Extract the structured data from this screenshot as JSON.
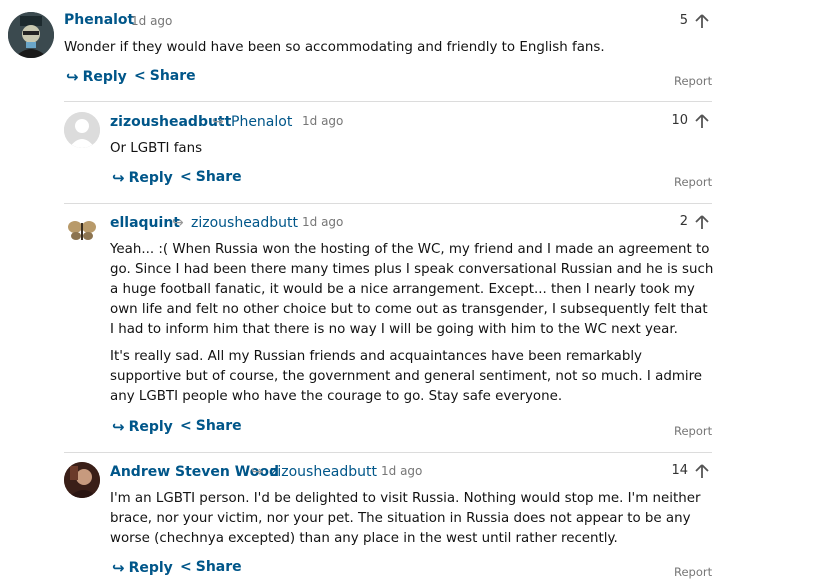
{
  "comments": [
    {
      "username": "Phenalot",
      "time": "1d ago",
      "votes": "5",
      "paragraphs": [
        "Wonder if they would have been so accommodating and friendly to English fans."
      ],
      "reply": "Reply",
      "share": "Share",
      "report": "Report"
    },
    {
      "username": "zizousheadbutt",
      "reply_to": "Phenalot",
      "time": "1d ago",
      "votes": "10",
      "paragraphs": [
        "Or LGBTI fans"
      ],
      "reply": "Reply",
      "share": "Share",
      "report": "Report"
    },
    {
      "username": "ellaquint",
      "reply_to": "zizousheadbutt",
      "time": "1d ago",
      "votes": "2",
      "paragraphs": [
        "Yeah... :( When Russia won the hosting of the WC, my friend and I made an agreement to go. Since I had been there many times plus I speak conversational Russian and he is such a huge football fanatic, it would be a nice arrangement. Except... then I nearly took my own life and felt no other choice but to come out as transgender, I subsequently felt that I had to inform him that there is no way I will be going with him to the WC next year.",
        "It's really sad. All my Russian friends and acquaintances have been remarkably supportive but of course, the government and general sentiment, not so much. I admire any LGBTI people who have the courage to go. Stay safe everyone."
      ],
      "reply": "Reply",
      "share": "Share",
      "report": "Report"
    },
    {
      "username": "Andrew Steven Wood",
      "reply_to": "zizousheadbutt",
      "time": "1d ago",
      "votes": "14",
      "paragraphs": [
        "I'm an LGBTI person. I'd be delighted to visit Russia. Nothing would stop me. I'm neither brace, nor your victim, nor your pet. The situation in Russia does not appear to be any worse (chechnya excepted) than any place in the west until rather recently."
      ],
      "reply": "Reply",
      "share": "Share",
      "report": "Report"
    }
  ],
  "colors": {
    "link": "#005689",
    "meta": "#767676",
    "divider": "#dcdcdc"
  }
}
